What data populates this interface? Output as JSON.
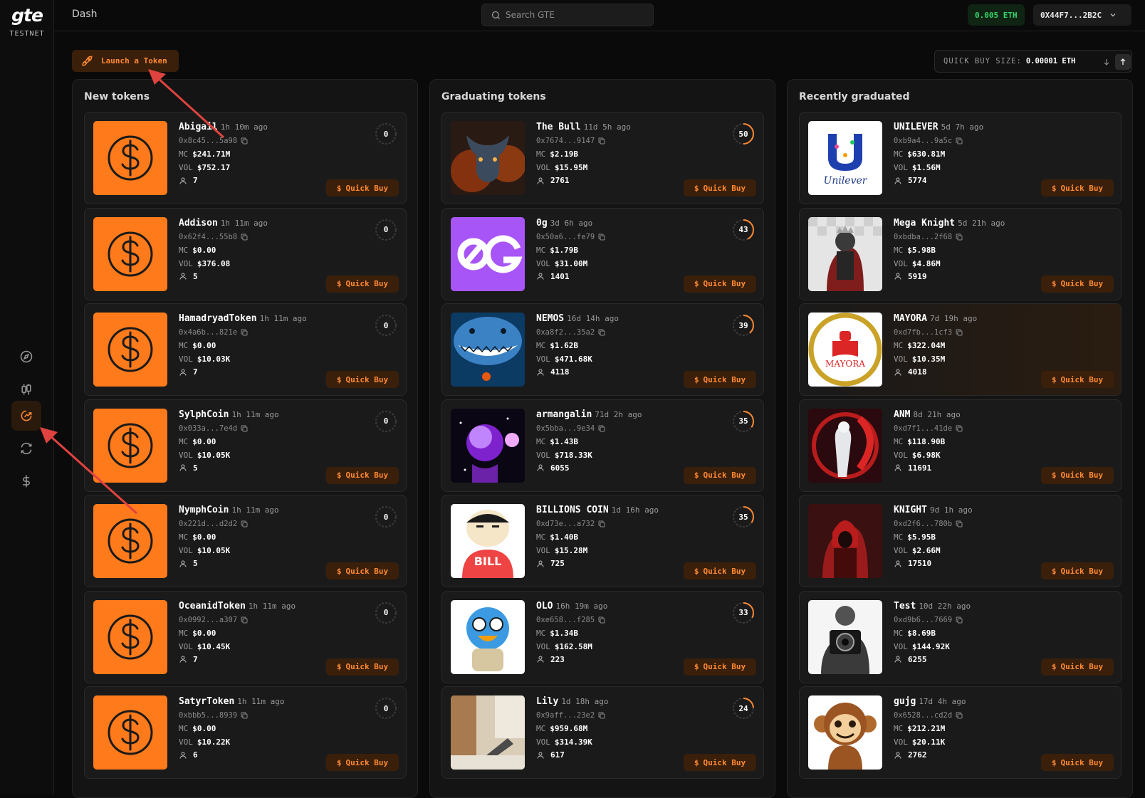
{
  "brand": {
    "logo": "gte",
    "network": "TESTNET"
  },
  "header": {
    "breadcrumb": "Dash",
    "search_placeholder": "Search GTE",
    "balance": "0.005 ETH",
    "wallet": "0X44F7...2B2C"
  },
  "toolbar": {
    "launch_label": "Launch a Token",
    "quick_buy_label": "QUICK BUY SIZE:",
    "quick_buy_value": "0.00001 ETH"
  },
  "labels": {
    "mc": "MC",
    "vol": "VOL",
    "quick_buy": "Quick Buy"
  },
  "colors": {
    "accent": "#ff8a33",
    "accent_bg": "#3a1f0a",
    "green": "#38d16a"
  },
  "columns": [
    {
      "title": "New tokens",
      "tokens": [
        {
          "name": "Abigail",
          "age": "1h 10m ago",
          "address": "0x8c45...5a98",
          "mc": "$241.71M",
          "vol": "$752.17",
          "holders": "7",
          "progress": 0,
          "image": "dollar"
        },
        {
          "name": "Addison",
          "age": "1h 11m ago",
          "address": "0x62f4...55b8",
          "mc": "$0.00",
          "vol": "$376.08",
          "holders": "5",
          "progress": 0,
          "image": "dollar"
        },
        {
          "name": "HamadryadToken",
          "age": "1h 11m ago",
          "address": "0x4a6b...821e",
          "mc": "$0.00",
          "vol": "$10.03K",
          "holders": "7",
          "progress": 0,
          "image": "dollar"
        },
        {
          "name": "SylphCoin",
          "age": "1h 11m ago",
          "address": "0x033a...7e4d",
          "mc": "$0.00",
          "vol": "$10.05K",
          "holders": "5",
          "progress": 0,
          "image": "dollar"
        },
        {
          "name": "NymphCoin",
          "age": "1h 11m ago",
          "address": "0x221d...d2d2",
          "mc": "$0.00",
          "vol": "$10.05K",
          "holders": "5",
          "progress": 0,
          "image": "dollar"
        },
        {
          "name": "OceanidToken",
          "age": "1h 11m ago",
          "address": "0x0992...a307",
          "mc": "$0.00",
          "vol": "$10.45K",
          "holders": "7",
          "progress": 0,
          "image": "dollar"
        },
        {
          "name": "SatyrToken",
          "age": "1h 11m ago",
          "address": "0xbbb5...8939",
          "mc": "$0.00",
          "vol": "$10.22K",
          "holders": "6",
          "progress": 0,
          "image": "dollar"
        }
      ]
    },
    {
      "title": "Graduating tokens",
      "tokens": [
        {
          "name": "The Bull",
          "age": "11d 5h ago",
          "address": "0x7674...9147",
          "mc": "$2.19B",
          "vol": "$15.95M",
          "holders": "2761",
          "progress": 50,
          "image": "bull"
        },
        {
          "name": "0g",
          "age": "3d 6h ago",
          "address": "0x50a6...fe79",
          "mc": "$1.79B",
          "vol": "$31.00M",
          "holders": "1401",
          "progress": 43,
          "image": "og"
        },
        {
          "name": "NEMOS",
          "age": "16d 14h ago",
          "address": "0xa8f2...35a2",
          "mc": "$1.62B",
          "vol": "$471.68K",
          "holders": "4118",
          "progress": 39,
          "image": "shark"
        },
        {
          "name": "armangalin",
          "age": "71d 2h ago",
          "address": "0x5bba...9e34",
          "mc": "$1.43B",
          "vol": "$718.33K",
          "holders": "6055",
          "progress": 35,
          "image": "space"
        },
        {
          "name": "BILLIONS COIN",
          "age": "1d 16h ago",
          "address": "0xd73e...a732",
          "mc": "$1.40B",
          "vol": "$15.28M",
          "holders": "725",
          "progress": 35,
          "image": "bill"
        },
        {
          "name": "OLO",
          "age": "16h 19m ago",
          "address": "0xe658...f285",
          "mc": "$1.34B",
          "vol": "$162.58M",
          "holders": "223",
          "progress": 33,
          "image": "bird"
        },
        {
          "name": "Lily",
          "age": "1d 18h ago",
          "address": "0x9aff...23e2",
          "mc": "$959.68M",
          "vol": "$314.39K",
          "holders": "617",
          "progress": 24,
          "image": "room"
        }
      ]
    },
    {
      "title": "Recently graduated",
      "tokens": [
        {
          "name": "UNILEVER",
          "age": "5d 7h ago",
          "address": "0xb9a4...9a5c",
          "mc": "$630.81M",
          "vol": "$1.56M",
          "holders": "5774",
          "image": "unilever"
        },
        {
          "name": "Mega Knight",
          "age": "5d 21h ago",
          "address": "0xbdba...2f68",
          "mc": "$5.98B",
          "vol": "$4.86M",
          "holders": "5919",
          "image": "knight"
        },
        {
          "name": "MAYORA",
          "age": "7d 19h ago",
          "address": "0xd7fb...1cf3",
          "mc": "$322.04M",
          "vol": "$10.35M",
          "holders": "4018",
          "image": "mayora",
          "highlight": true
        },
        {
          "name": "ANM",
          "age": "8d 21h ago",
          "address": "0xd7f1...41de",
          "mc": "$118.90B",
          "vol": "$6.98K",
          "holders": "11691",
          "image": "anm"
        },
        {
          "name": "KNIGHT",
          "age": "9d 1h ago",
          "address": "0xd2f6...780b",
          "mc": "$5.95B",
          "vol": "$2.66M",
          "holders": "17510",
          "image": "redknight"
        },
        {
          "name": "Test",
          "age": "10d 22h ago",
          "address": "0xd9b6...7669",
          "mc": "$8.69B",
          "vol": "$144.92K",
          "holders": "6255",
          "image": "camera"
        },
        {
          "name": "gujg",
          "age": "17d 4h ago",
          "address": "0x6528...cd2d",
          "mc": "$212.21M",
          "vol": "$20.11K",
          "holders": "2762",
          "image": "monkey"
        }
      ]
    }
  ]
}
